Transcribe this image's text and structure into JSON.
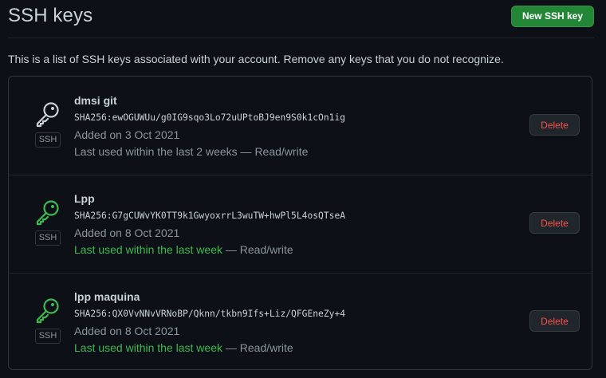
{
  "header": {
    "title": "SSH keys",
    "new_key_label": "New SSH key"
  },
  "intro_text": "This is a list of SSH keys associated with your account. Remove any keys that you do not recognize.",
  "colors": {
    "accent_green": "#238636",
    "recent_green": "#3fb950",
    "danger": "#f85149",
    "inactive_key_icon": "#c9d1d9"
  },
  "keys": [
    {
      "icon": "key-icon",
      "icon_state": "inactive",
      "badge": "SSH",
      "name": "dmsi git",
      "fingerprint": "SHA256:ewOGUWUu/g0IG9sqo3Lo72uUPtoBJ9en9S0k1cOn1ig",
      "added": "Added on 3 Oct 2021",
      "usage_highlight": "",
      "usage_text": "Last used within the last 2 weeks — Read/write",
      "delete_label": "Delete"
    },
    {
      "icon": "key-icon",
      "icon_state": "recent",
      "badge": "SSH",
      "name": "Lpp",
      "fingerprint": "SHA256:G7gCUWvYK0TT9k1GwyoxrrL3wuTW+hwPl5L4osQTseA",
      "added": "Added on 8 Oct 2021",
      "usage_highlight": "Last used within the last week",
      "usage_text": " — Read/write",
      "delete_label": "Delete"
    },
    {
      "icon": "key-icon",
      "icon_state": "recent",
      "badge": "SSH",
      "name": "lpp maquina",
      "fingerprint": "SHA256:QX0VvNNvVRNoBP/Qknn/tkbn9Ifs+Liz/QFGEneZy+4",
      "added": "Added on 8 Oct 2021",
      "usage_highlight": "Last used within the last week",
      "usage_text": " — Read/write",
      "delete_label": "Delete"
    }
  ]
}
